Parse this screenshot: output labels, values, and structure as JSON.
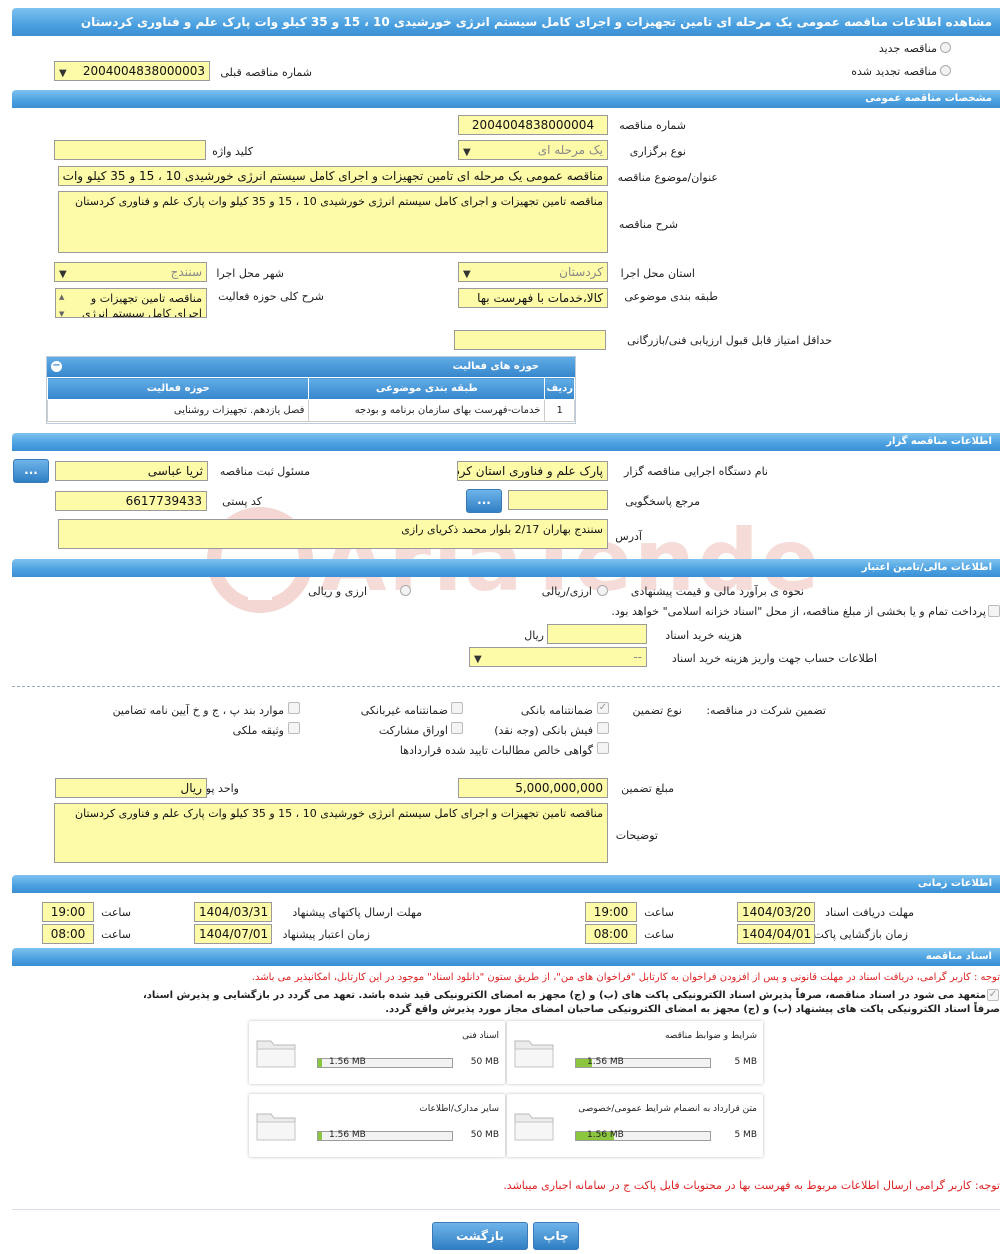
{
  "title": "مشاهده اطلاعات مناقصه عمومی یک مرحله ای تامین تجهیزات و اجرای کامل سیستم انرژی خورشیدی 10 ، 15 و 35 کیلو وات پارک علم و فناوری کردستان",
  "tender_type": {
    "new_label": "مناقصه جدید",
    "renewed_label": "مناقصه تجدید شده",
    "prev_number_label": "شماره مناقصه قبلی",
    "prev_number_value": "2004004838000003"
  },
  "general": {
    "header": "مشخصات مناقصه عمومی",
    "number_label": "شماره مناقصه",
    "number_value": "2004004838000004",
    "holding_type_label": "نوع برگزاری",
    "holding_type_value": "یک مرحله ای",
    "keyword_label": "کلید واژه",
    "keyword_value": "",
    "subject_label": "عنوان/موضوع مناقصه",
    "subject_value": "مناقصه عمومی یک مرحله ای  تامین تجهیزات و اجرای کامل سیستم انرژی خورشیدی 10 ، 15 و 35 کیلو وات",
    "description_label": "شرح مناقصه",
    "description_value": "مناقصه تامین تجهیزات و اجرای کامل سیستم انرژی خورشیدی 10 ، 15 و 35 کیلو وات پارک علم و فناوری کردستان",
    "province_label": "استان محل اجرا",
    "province_value": "کردستان",
    "city_label": "شهر محل اجرا",
    "city_value": "سنندج",
    "category_label": "طبقه بندی موضوعی",
    "category_value": "کالا،خدمات با فهرست بها",
    "activity_desc_label": "شرح کلی حوزه فعالیت",
    "activity_desc_value": "مناقصه تامین تجهیزات و اجرای کامل سیستم انرژی",
    "min_score_label": "حداقل امتیاز قابل قبول ارزیابی فنی/بازرگانی",
    "min_score_value": ""
  },
  "activity_table": {
    "title": "حوزه های فعالیت",
    "headers": [
      "ردیف",
      "طبقه بندی موضوعی",
      "حوزه فعالیت"
    ],
    "rows": [
      [
        "1",
        "خدمات-فهرست بهای سازمان برنامه و بودجه",
        "فصل یازدهم. تجهیزات روشنایی"
      ]
    ]
  },
  "organizer": {
    "header": "اطلاعات مناقصه گزار",
    "org_label": "نام دستگاه اجرایی مناقصه گزار",
    "org_value": "پارک علم و فناوری استان کردستان",
    "registrar_label": "مسئول ثبت مناقصه",
    "registrar_value": "ثریا عباسی",
    "reference_label": "مرجع پاسخگویی",
    "reference_value": "",
    "postal_label": "کد پستی",
    "postal_value": "6617739433",
    "address_label": "آدرس",
    "address_value": "سنندج بهاران  2/17 بلوار محمد ذکریای رازی",
    "dots": "..."
  },
  "financial": {
    "header": "اطلاعات مالی/تامین اعتبار",
    "estimate_label": "نحوه ی برآورد مالی و قیمت پیشنهادی",
    "opt1": "ارزی/ریالی",
    "opt2": "ارزی و ریالی",
    "treasury_text": "پرداخت تمام و یا بخشی از مبلغ مناقصه، از محل \"اسناد خزانه اسلامی\" خواهد بود.",
    "doc_cost_label": "هزینه خرید اسناد",
    "doc_cost_value": "",
    "doc_cost_unit": "ریال",
    "account_label": "اطلاعات حساب جهت واریز هزینه خرید اسناد",
    "account_value": "--"
  },
  "guarantee": {
    "section_label": "تضمین شرکت در مناقصه:",
    "type_label": "نوع تضمین",
    "options": [
      "ضمانتنامه بانکی",
      "ضمانتنامه غیربانکی",
      "موارد بند پ ، ج و خ آیین نامه تضامین",
      "فیش بانکی (وجه نقد)",
      "اوراق مشارکت",
      "وثیقه ملکی",
      "گواهی خالص مطالبات تایید شده قراردادها"
    ],
    "amount_label": "مبلغ تضمین",
    "amount_value": "5,000,000,000",
    "currency_label": "واحد پول",
    "currency_value": "ریال",
    "notes_label": "توضیحات",
    "notes_value": "مناقصه تامین تجهیزات و اجرای کامل سیستم انرژی خورشیدی 10 ، 15 و 35 کیلو وات پارک علم و فناوری کردستان"
  },
  "timing": {
    "header": "اطلاعات زمانی",
    "receive_deadline_label": "مهلت دریافت اسناد",
    "receive_deadline_date": "1404/03/20",
    "send_deadline_label": "مهلت ارسال پاکتهای پیشنهاد",
    "send_deadline_date": "1404/03/31",
    "opening_label": "زمان بازگشایی پاکت ها",
    "opening_date": "1404/04/01",
    "validity_label": "زمان اعتبار پیشنهاد",
    "validity_date": "1404/07/01",
    "time_label": "ساعت",
    "receive_time": "19:00",
    "send_time": "19:00",
    "opening_time": "08:00",
    "validity_time": "08:00"
  },
  "documents": {
    "header": "اسناد مناقصه",
    "notice": "توجه : کاربر گرامی، دریافت اسناد در مهلت قانونی و پس از افزودن فراخوان به کارتابل \"فراخوان های من\"، از طریق ستون \"دانلود اسناد\" موجود در این کارتابل، امکانپذیر می باشد.",
    "commit_line1": "متعهد می شود در اسناد مناقصه، صرفاً پذیرش اسناد الکترونیکی پاکت های (ب) و (ج) مجهز به امضای الکترونیکی قید شده باشد. تعهد می گردد در بازگشایی و پذیرش اسناد،",
    "commit_line2": "صرفاً اسناد الکترونیکی پاکت های پیشنهاد (ب) و (ج) مجهز به امضای الکترونیکی صاحبان امضای مجاز مورد پذیرش واقع گردد.",
    "files": [
      {
        "title": "شرایط و ضوابط مناقصه",
        "max": "5 MB",
        "used": "1.56 MB",
        "fill": 0.12
      },
      {
        "title": "اسناد فنی",
        "max": "50 MB",
        "used": "1.56 MB",
        "fill": 0.03
      },
      {
        "title": "متن قرارداد به انضمام شرایط عمومی/خصوصی",
        "max": "5 MB",
        "used": "1.56 MB",
        "fill": 0.28
      },
      {
        "title": "سایر مدارک/اطلاعات",
        "max": "50 MB",
        "used": "1.56 MB",
        "fill": 0.03
      }
    ],
    "bottom_notice": "توجه: کاربر گرامی ارسال اطلاعات مربوط به فهرست بها در محتویات فایل پاکت ج در سامانه اجباری میباشد."
  },
  "buttons": {
    "print": "چاپ",
    "back": "بازگشت"
  },
  "watermark": "AriaTender.neT",
  "colors": {
    "bar": "#4aa0e0",
    "field": "#fdfba8",
    "notice_red": "#dd2222",
    "progress": "#8cc63f"
  }
}
